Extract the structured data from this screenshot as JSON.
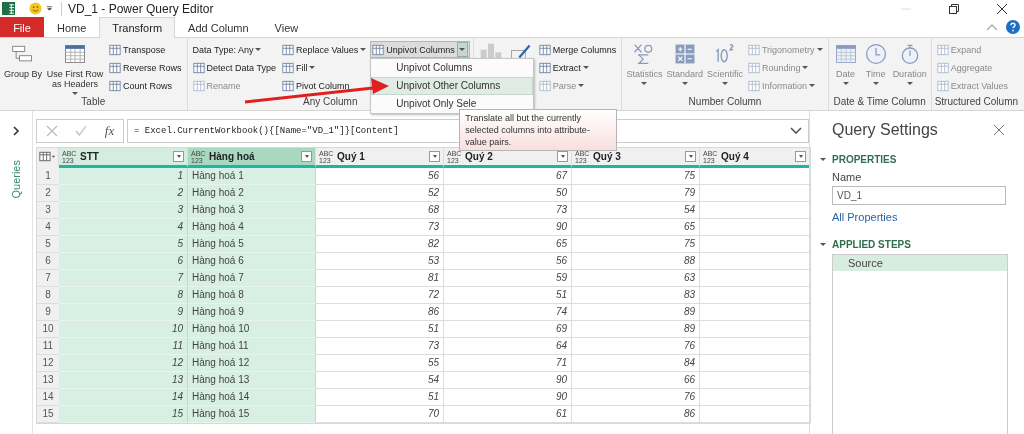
{
  "window": {
    "title": "VD_1 - Power Query Editor"
  },
  "tabs": [
    {
      "label": "File",
      "kind": "file",
      "selected": false
    },
    {
      "label": "Home",
      "kind": "tab",
      "selected": false
    },
    {
      "label": "Transform",
      "kind": "tab",
      "selected": true
    },
    {
      "label": "Add Column",
      "kind": "tab",
      "selected": false
    },
    {
      "label": "View",
      "kind": "tab",
      "selected": false
    }
  ],
  "ribbon": {
    "groups": [
      {
        "label": "Table",
        "items": [
          {
            "kind": "large",
            "label": "Group By",
            "disabled": false,
            "dropdown": false
          },
          {
            "kind": "large",
            "label": "Use First Row as Headers",
            "disabled": false,
            "dropdown": true
          },
          {
            "kind": "stack",
            "items": [
              {
                "label": "Transpose",
                "disabled": false,
                "dropdown": false
              },
              {
                "label": "Reverse Rows",
                "disabled": false,
                "dropdown": false
              },
              {
                "label": "Count Rows",
                "disabled": false,
                "dropdown": false
              }
            ]
          }
        ]
      },
      {
        "label": "Any Column",
        "items": [
          {
            "kind": "stack",
            "items": [
              {
                "label": "Data Type: Any",
                "disabled": false,
                "dropdown": true,
                "noicon": true
              },
              {
                "label": "Detect Data Type",
                "disabled": false,
                "dropdown": false
              },
              {
                "label": "Rename",
                "disabled": true,
                "dropdown": false
              }
            ]
          },
          {
            "kind": "stack",
            "items": [
              {
                "label": "Replace Values",
                "disabled": false,
                "dropdown": true
              },
              {
                "label": "Fill",
                "disabled": false,
                "dropdown": true
              },
              {
                "label": "Pivot Column",
                "disabled": false,
                "dropdown": false
              }
            ]
          },
          {
            "kind": "stack",
            "items": [
              {
                "label": "Unpivot Columns",
                "disabled": false,
                "dropdown": true,
                "open": true
              }
            ]
          }
        ]
      },
      {
        "items": [
          {
            "kind": "large"
          },
          {
            "kind": "large"
          },
          {
            "kind": "stack",
            "items": [
              {
                "label": "Merge Columns",
                "disabled": false,
                "dropdown": false
              },
              {
                "label": "Extract",
                "disabled": false,
                "dropdown": true
              },
              {
                "label": "Parse",
                "disabled": true,
                "dropdown": true
              }
            ]
          }
        ]
      },
      {
        "label": "Number Column",
        "items": [
          {
            "kind": "large",
            "label": "Statistics",
            "disabled": true,
            "dropdown": true
          },
          {
            "kind": "large",
            "label": "Standard",
            "disabled": true,
            "dropdown": true
          },
          {
            "kind": "large",
            "label": "Scientific",
            "disabled": true,
            "dropdown": true
          },
          {
            "kind": "stack",
            "items": [
              {
                "label": "Trigonometry",
                "disabled": true,
                "dropdown": true
              },
              {
                "label": "Rounding",
                "disabled": true,
                "dropdown": true
              },
              {
                "label": "Information",
                "disabled": true,
                "dropdown": true
              }
            ]
          }
        ]
      },
      {
        "label": "Date & Time Column",
        "items": [
          {
            "kind": "large",
            "label": "Date",
            "disabled": true,
            "dropdown": true
          },
          {
            "kind": "large",
            "label": "Time",
            "disabled": true,
            "dropdown": true
          },
          {
            "kind": "large",
            "label": "Duration",
            "disabled": true,
            "dropdown": true
          }
        ]
      },
      {
        "label": "Structured Column",
        "items": [
          {
            "kind": "stack",
            "items": [
              {
                "label": "Expand",
                "disabled": true,
                "dropdown": false
              },
              {
                "label": "Aggregate",
                "disabled": true,
                "dropdown": false
              },
              {
                "label": "Extract Values",
                "disabled": true,
                "dropdown": false
              }
            ]
          }
        ]
      }
    ]
  },
  "menu": {
    "items": [
      {
        "label": "Unpivot Columns",
        "selected": false
      },
      {
        "label": "Unpivot Other Columns",
        "selected": true
      },
      {
        "label": "Unpivot Only Sele",
        "selected": false
      }
    ]
  },
  "tooltip": "Translate all but the currently selected columns into attribute-value pairs.",
  "queries_pane": {
    "label": "Queries"
  },
  "formula_bar": {
    "fx": "fx",
    "formula": "= Excel.CurrentWorkbook(){[Name=\"VD_1\"]}[Content]"
  },
  "table": {
    "columns": [
      {
        "type": "ABC 123",
        "name": "STT",
        "kind": "number",
        "selected": true,
        "focused": false
      },
      {
        "type": "ABC 123",
        "name": "Hàng hoá",
        "kind": "text",
        "selected": true,
        "focused": true
      },
      {
        "type": "ABC 123",
        "name": "Quý 1",
        "kind": "number",
        "selected": false,
        "focused": false
      },
      {
        "type": "ABC 123",
        "name": "Quý 2",
        "kind": "number",
        "selected": false,
        "focused": false
      },
      {
        "type": "ABC 123",
        "name": "Quý 3",
        "kind": "number",
        "selected": false,
        "focused": false
      },
      {
        "type": "ABC 123",
        "name": "Quý 4",
        "kind": "number",
        "selected": false,
        "focused": false
      }
    ],
    "rows": [
      {
        "n": "1",
        "cells": [
          "1",
          "Hàng hoá 1",
          "56",
          "67",
          "75"
        ]
      },
      {
        "n": "2",
        "cells": [
          "2",
          "Hàng hoá 2",
          "52",
          "50",
          "79"
        ]
      },
      {
        "n": "3",
        "cells": [
          "3",
          "Hàng hoá 3",
          "68",
          "73",
          "54"
        ]
      },
      {
        "n": "4",
        "cells": [
          "4",
          "Hàng hoá 4",
          "73",
          "90",
          "65"
        ]
      },
      {
        "n": "5",
        "cells": [
          "5",
          "Hàng hoá 5",
          "82",
          "65",
          "75"
        ]
      },
      {
        "n": "6",
        "cells": [
          "6",
          "Hàng hoá 6",
          "53",
          "56",
          "88"
        ]
      },
      {
        "n": "7",
        "cells": [
          "7",
          "Hàng hoá 7",
          "81",
          "59",
          "63"
        ]
      },
      {
        "n": "8",
        "cells": [
          "8",
          "Hàng hoá 8",
          "72",
          "51",
          "83"
        ]
      },
      {
        "n": "9",
        "cells": [
          "9",
          "Hàng hoá 9",
          "86",
          "74",
          "89"
        ]
      },
      {
        "n": "10",
        "cells": [
          "10",
          "Hàng hoá 10",
          "51",
          "69",
          "89"
        ]
      },
      {
        "n": "11",
        "cells": [
          "11",
          "Hàng hoá 11",
          "73",
          "64",
          "76"
        ]
      },
      {
        "n": "12",
        "cells": [
          "12",
          "Hàng hoá 12",
          "55",
          "71",
          "84"
        ]
      },
      {
        "n": "13",
        "cells": [
          "13",
          "Hàng hoá 13",
          "54",
          "90",
          "66"
        ]
      },
      {
        "n": "14",
        "cells": [
          "14",
          "Hàng hoá 14",
          "51",
          "90",
          "76"
        ]
      },
      {
        "n": "15",
        "cells": [
          "15",
          "Hàng hoá 15",
          "70",
          "61",
          "86"
        ]
      }
    ]
  },
  "query_settings": {
    "title": "Query Settings",
    "properties": {
      "heading": "PROPERTIES",
      "expanded": true,
      "name_label": "Name",
      "name_value": "VD_1",
      "link": "All Properties"
    },
    "steps": {
      "heading": "APPLIED STEPS",
      "expanded": true,
      "items": [
        {
          "label": "Source",
          "selected": true
        }
      ]
    }
  }
}
